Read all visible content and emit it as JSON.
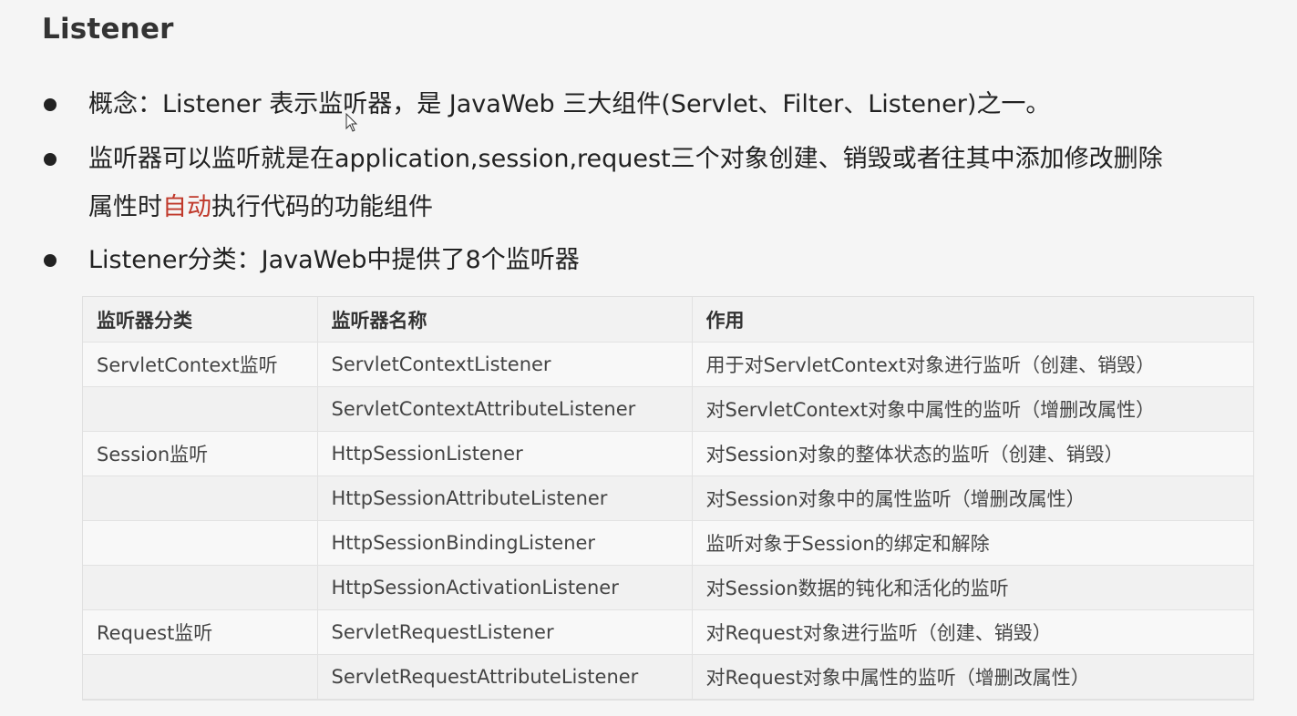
{
  "title": "Listener",
  "bullets": [
    {
      "text": "概念：Listener 表示监听器，是 JavaWeb 三大组件(Servlet、Filter、Listener)之一。"
    },
    {
      "line1": "监听器可以监听就是在application,session,request三个对象创建、销毁或者往其中添加修改删除",
      "line2_before": "属性时",
      "line2_highlight": "自动",
      "line2_after": "执行代码的功能组件",
      "highlight_color": "#c0392b"
    },
    {
      "text": "Listener分类：JavaWeb中提供了8个监听器"
    }
  ],
  "table": {
    "headers": [
      "监听器分类",
      "监听器名称",
      "作用"
    ],
    "rows": [
      [
        "ServletContext监听",
        "ServletContextListener",
        "用于对ServletContext对象进行监听（创建、销毁）"
      ],
      [
        "",
        "ServletContextAttributeListener",
        "对ServletContext对象中属性的监听（增删改属性）"
      ],
      [
        "Session监听",
        "HttpSessionListener",
        "对Session对象的整体状态的监听（创建、销毁）"
      ],
      [
        "",
        "HttpSessionAttributeListener",
        "对Session对象中的属性监听（增删改属性）"
      ],
      [
        "",
        "HttpSessionBindingListener",
        "监听对象于Session的绑定和解除"
      ],
      [
        "",
        "HttpSessionActivationListener",
        "对Session数据的钝化和活化的监听"
      ],
      [
        "Request监听",
        "ServletRequestListener",
        "对Request对象进行监听（创建、销毁）"
      ],
      [
        "",
        "ServletRequestAttributeListener",
        "对Request对象中属性的监听（增删改属性）"
      ]
    ]
  }
}
